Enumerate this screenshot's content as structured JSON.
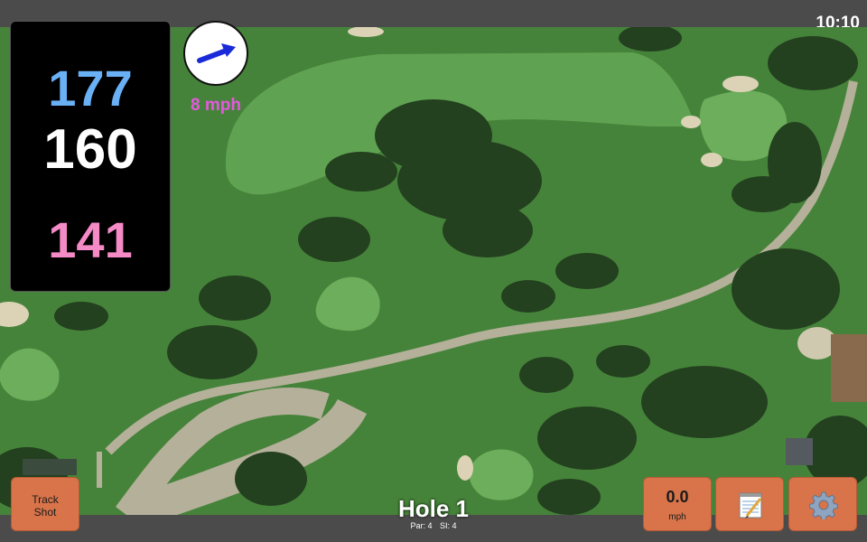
{
  "status": {
    "time": "10:10"
  },
  "distances": {
    "back": "177",
    "middle": "160",
    "front": "141"
  },
  "wind": {
    "speed_text": "8 mph",
    "direction_icon": "wind-arrow-icon"
  },
  "hole": {
    "title": "Hole 1",
    "par": "Par: 4",
    "stroke_index": "SI: 4"
  },
  "buttons": {
    "track_shot_line1": "Track",
    "track_shot_line2": "Shot",
    "wind_value": "0.0",
    "wind_unit": "mph",
    "notes_icon": "notepad-icon",
    "settings_icon": "gear-icon"
  },
  "colors": {
    "back_distance": "#6ab0f5",
    "middle_distance": "#ffffff",
    "front_distance": "#f48ac6",
    "wind_text": "#e657e0",
    "button": "#d9744a"
  }
}
